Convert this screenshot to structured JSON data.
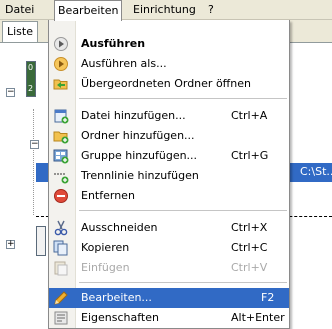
{
  "menubar": {
    "items": [
      "Datei",
      "Bearbeiten",
      "Einrichtung",
      "?"
    ]
  },
  "tabs": {
    "active": "Liste"
  },
  "tree": {
    "selected_path_fragment": "C:\\St...",
    "node_labels": [
      "0",
      "2"
    ]
  },
  "menu": {
    "items": [
      {
        "label": "Ausführen",
        "shortcut": "",
        "icon": "play-icon",
        "bold": true
      },
      {
        "label": "Ausführen als...",
        "shortcut": "",
        "icon": "play-as-icon"
      },
      {
        "label": "Übergeordneten Ordner öffnen",
        "shortcut": "",
        "icon": "open-folder-icon"
      },
      {
        "label": "Datei hinzufügen...",
        "shortcut": "Ctrl+A",
        "icon": "add-file-icon"
      },
      {
        "label": "Ordner hinzufügen...",
        "shortcut": "",
        "icon": "add-folder-icon"
      },
      {
        "label": "Gruppe hinzufügen...",
        "shortcut": "Ctrl+G",
        "icon": "add-group-icon"
      },
      {
        "label": "Trennlinie hinzufügen",
        "shortcut": "",
        "icon": "separator-icon"
      },
      {
        "label": "Entfernen",
        "shortcut": "",
        "icon": "remove-icon"
      },
      {
        "label": "Ausschneiden",
        "shortcut": "Ctrl+X",
        "icon": "cut-icon"
      },
      {
        "label": "Kopieren",
        "shortcut": "Ctrl+C",
        "icon": "copy-icon"
      },
      {
        "label": "Einfügen",
        "shortcut": "Ctrl+V",
        "icon": "paste-icon",
        "disabled": true
      },
      {
        "label": "Bearbeiten...",
        "shortcut": "F2",
        "icon": "edit-pencil-icon",
        "highlighted": true
      },
      {
        "label": "Eigenschaften",
        "shortcut": "Alt+Enter",
        "icon": "properties-icon"
      }
    ]
  }
}
